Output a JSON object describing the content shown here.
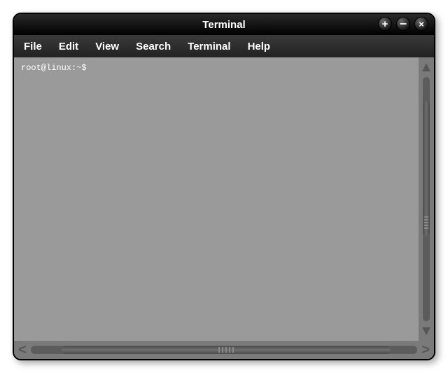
{
  "window": {
    "title": "Terminal"
  },
  "menubar": {
    "items": [
      "File",
      "Edit",
      "View",
      "Search",
      "Terminal",
      "Help"
    ]
  },
  "terminal": {
    "prompt": "root@linux:~$"
  },
  "controls": {
    "new": "+",
    "minimize": "–",
    "close": "×"
  }
}
